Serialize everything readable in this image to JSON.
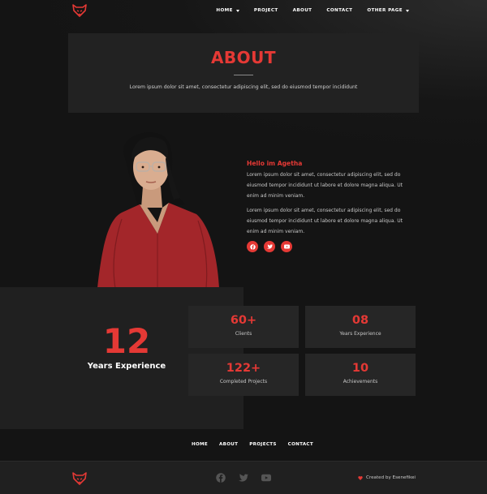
{
  "nav": {
    "items": [
      {
        "label": "HOME",
        "dropdown": true
      },
      {
        "label": "PROJECT",
        "dropdown": false
      },
      {
        "label": "ABOUT",
        "dropdown": false
      },
      {
        "label": "CONTACT",
        "dropdown": false
      },
      {
        "label": "OTHER PAGE",
        "dropdown": true
      }
    ]
  },
  "hero": {
    "title": "ABOUT",
    "subtitle": "Lorem ipsum dolor sit amet, consectetur adipiscing elit, sed do eiusmod tempor incididunt"
  },
  "intro": {
    "greeting": "Hello im Agetha",
    "paragraph1": "Lorem ipsum dolor sit amet, consectetur adipiscing elit, sed do eiusmod tempor incididunt ut labore et dolore magna aliqua. Ut enim ad minim veniam.",
    "paragraph2": "Lorem ipsum dolor sit amet, consectetur adipiscing elit, sed do eiusmod tempor incididunt ut labore et dolore magna aliqua. Ut enim ad minim veniam.",
    "socials": [
      "facebook-icon",
      "twitter-icon",
      "youtube-icon"
    ]
  },
  "experience": {
    "number": "12",
    "label": "Years Experience"
  },
  "stats": [
    {
      "value": "60+",
      "label": "Clients"
    },
    {
      "value": "08",
      "label": "Years Experience"
    },
    {
      "value": "122+",
      "label": "Completed Projects"
    },
    {
      "value": "10",
      "label": "Achievements"
    }
  ],
  "footer_nav": [
    "HOME",
    "ABOUT",
    "PROJECTS",
    "CONTACT"
  ],
  "footer": {
    "credit": "Created by Esenefikei",
    "icons": [
      "facebook-icon",
      "twitter-icon",
      "youtube-icon"
    ]
  },
  "colors": {
    "accent": "#e53935",
    "background": "#141414",
    "panel": "#222222"
  }
}
